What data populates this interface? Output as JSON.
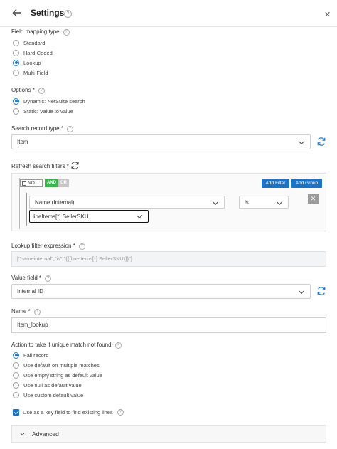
{
  "header": {
    "title": "Settings",
    "help": "?",
    "close": "✕",
    "back_icon": "arrow-left-icon"
  },
  "field_mapping_type": {
    "label": "Field mapping type",
    "options": [
      "Standard",
      "Hard-Coded",
      "Lookup",
      "Multi-Field"
    ],
    "selected": "Lookup"
  },
  "options": {
    "label": "Options *",
    "items": [
      "Dynamic: NetSuite search",
      "Static: Value to value"
    ],
    "selected": "Dynamic: NetSuite search"
  },
  "search_record_type": {
    "label": "Search record type *",
    "value": "Item"
  },
  "refresh_search_filters": {
    "label": "Refresh search filters *",
    "not_label": "NOT",
    "and_label": "AND",
    "or_label": "OR",
    "add_filter_label": "Add Filter",
    "add_group_label": "Add Group",
    "field_value": "Name (Internal)",
    "operator_value": "is",
    "operand_value": "lineItems[*].SellerSKU",
    "remove_label": "✕"
  },
  "lookup_filter_expression": {
    "label": "Lookup filter expression *",
    "value": "[\"nameinternal\",\"is\",\"{{{lineItems[*].SellerSKU}}}\"]"
  },
  "value_field": {
    "label": "Value field *",
    "value": "Internal ID"
  },
  "name_field": {
    "label": "Name *",
    "value": "Item_lookup"
  },
  "action_if_not_found": {
    "label": "Action to take if unique match not found",
    "options": [
      "Fail record",
      "Use default on multiple matches",
      "Use empty string as default value",
      "Use null as default value",
      "Use custom default value"
    ],
    "selected": "Fail record"
  },
  "key_field": {
    "label": "Use as a key field to find existing lines",
    "checked": true
  },
  "advanced": {
    "label": "Advanced"
  },
  "colors": {
    "accent": "#1a73c7",
    "and_green": "#3bb54a",
    "or_gray": "#c5c5c5"
  }
}
